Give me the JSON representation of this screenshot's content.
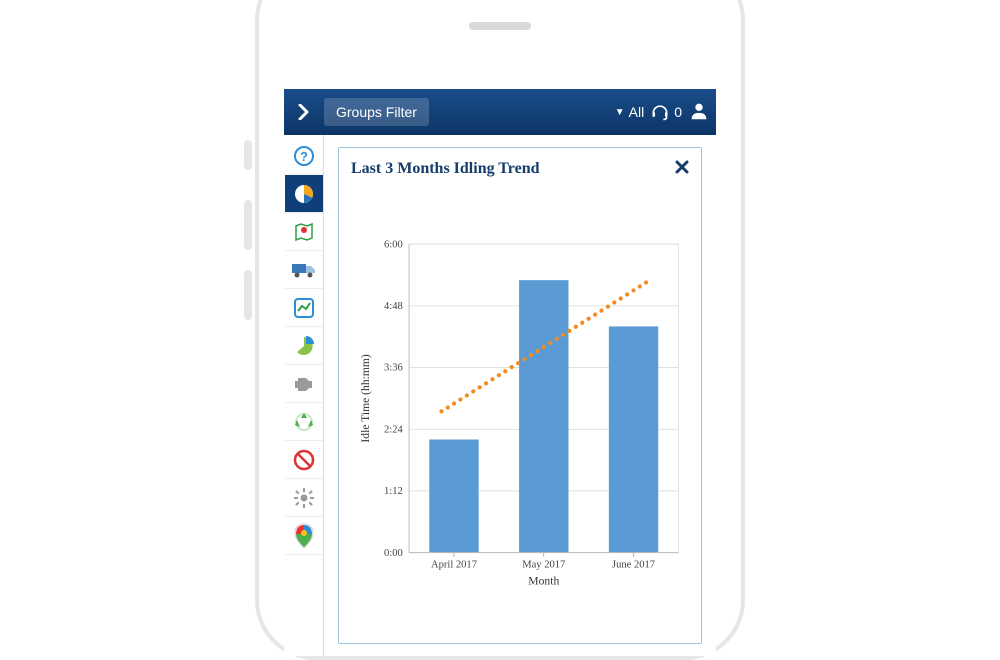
{
  "header": {
    "filter_label": "Groups Filter",
    "dropdown_value": "All",
    "notification_count": "0"
  },
  "sidebar": {
    "items": [
      {
        "name": "help"
      },
      {
        "name": "dashboard"
      },
      {
        "name": "map"
      },
      {
        "name": "fleet"
      },
      {
        "name": "trend"
      },
      {
        "name": "pie-report"
      },
      {
        "name": "engine"
      },
      {
        "name": "recycle"
      },
      {
        "name": "prohibit"
      },
      {
        "name": "settings"
      },
      {
        "name": "pin-colored"
      }
    ]
  },
  "card": {
    "title": "Last 3 Months Idling Trend"
  },
  "chart_data": {
    "type": "bar",
    "title": "Last 3 Months Idling Trend",
    "xlabel": "Month",
    "ylabel": "Idle Time (hh:mm)",
    "categories": [
      "April 2017",
      "May 2017",
      "June 2017"
    ],
    "y_ticks": [
      "0:00",
      "1:12",
      "2:24",
      "3:36",
      "4:48",
      "6:00"
    ],
    "ylim_minutes": [
      0,
      360
    ],
    "series": [
      {
        "name": "Idle Time",
        "type": "bar",
        "color": "#5b9bd5",
        "values_hhmm": [
          "2:12",
          "5:18",
          "4:24"
        ],
        "values_minutes": [
          132,
          318,
          264
        ]
      },
      {
        "name": "Trend",
        "type": "line-dotted",
        "color": "#f28c1f",
        "values_hhmm": [
          "2:54",
          "4:00",
          "5:06"
        ],
        "values_minutes": [
          174,
          240,
          306
        ]
      }
    ]
  }
}
